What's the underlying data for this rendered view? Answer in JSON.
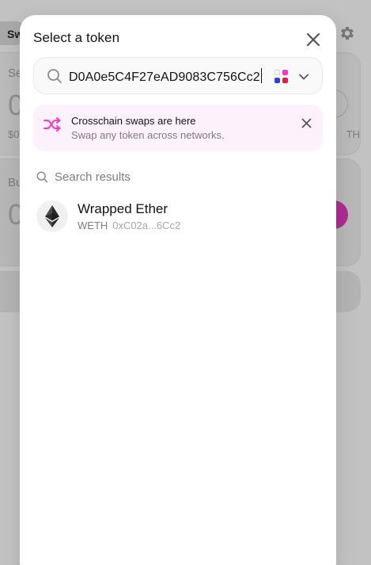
{
  "background": {
    "tab_label": "Sw",
    "sell_label": "Se",
    "sell_amount": "0",
    "sell_usd": "$0",
    "sell_token": "TH",
    "buy_label": "Bu",
    "buy_amount": "0"
  },
  "modal": {
    "title": "Select a token",
    "search": {
      "value": "D0A0e5C4F27eAD9083C756Cc2"
    },
    "banner": {
      "title": "Crosschain swaps are here",
      "subtitle": "Swap any token across networks."
    },
    "results_header": "Search results",
    "results": [
      {
        "name": "Wrapped Ether",
        "symbol": "WETH",
        "address": "0xC02a...6Cc2",
        "logo_icon": "ethereum-icon"
      }
    ]
  },
  "colors": {
    "accent_pink": "#FC37C8",
    "banner_bg": "#FDF1FB",
    "text_primary": "#131313",
    "text_secondary": "#7D7D7D",
    "chain_blue": "#2F3FE6"
  }
}
